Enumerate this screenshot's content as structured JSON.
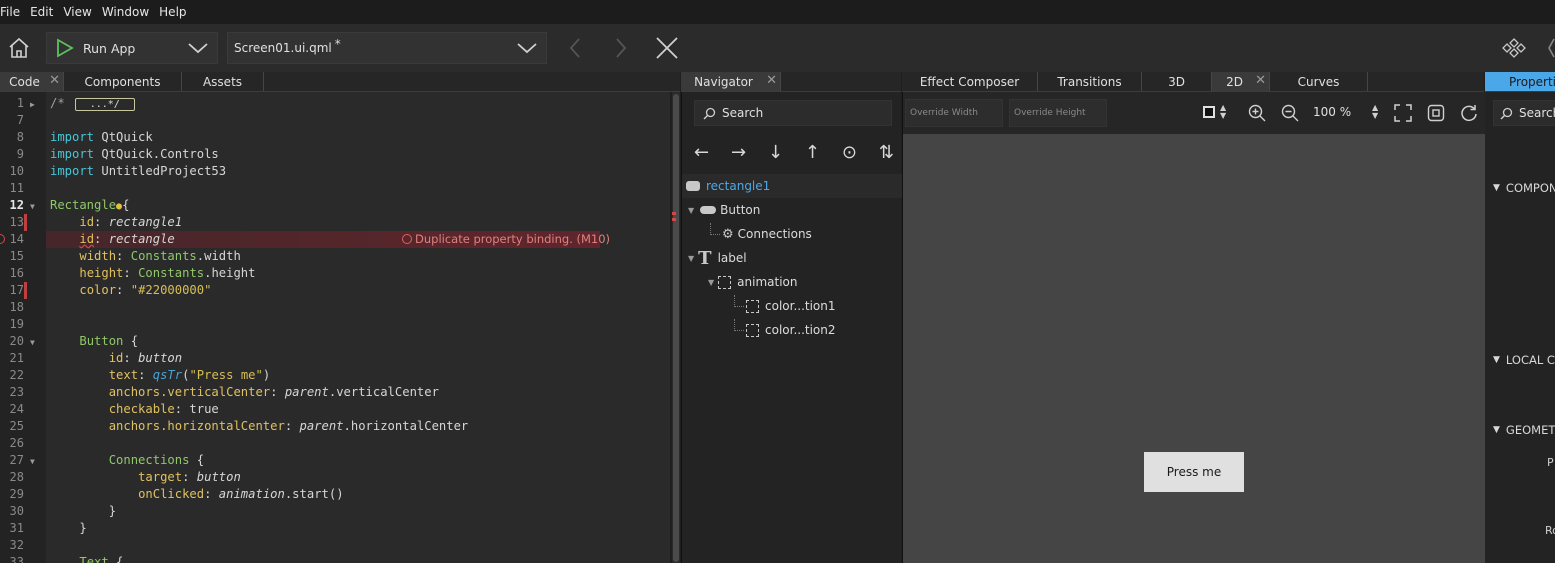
{
  "menu": [
    "File",
    "Edit",
    "View",
    "Window",
    "Help"
  ],
  "toolbar": {
    "run_label": "Run App",
    "file_label": "Screen01.ui.qml",
    "modified_marker": "*"
  },
  "colors": {
    "accent": "#4aa8e8",
    "error": "#d04848",
    "play": "#5cc25c"
  },
  "editor_tabs": [
    {
      "label": "Code",
      "active": true
    },
    {
      "label": "Components",
      "active": false
    },
    {
      "label": "Assets",
      "active": false
    }
  ],
  "navigator_tab": "Navigator",
  "view_tabs": [
    {
      "label": "Effect Composer",
      "active": false
    },
    {
      "label": "Transitions",
      "active": false
    },
    {
      "label": "3D",
      "active": false
    },
    {
      "label": "2D",
      "active": true
    },
    {
      "label": "Curves",
      "active": false
    }
  ],
  "properties_tab": "Properties",
  "code_lines": [
    {
      "n": "1",
      "text": "/*",
      "collapsed": "...*/"
    },
    {
      "n": "7",
      "text": ""
    },
    {
      "n": "8",
      "text": "import QtQuick"
    },
    {
      "n": "9",
      "text": "import QtQuick.Controls"
    },
    {
      "n": "10",
      "text": "import UntitledProject53"
    },
    {
      "n": "11",
      "text": ""
    },
    {
      "n": "12",
      "text": "Rectangle {"
    },
    {
      "n": "13",
      "text": "id: rectangle1"
    },
    {
      "n": "14",
      "text": "id: rectangle"
    },
    {
      "n": "15",
      "text": "width: Constants.width"
    },
    {
      "n": "16",
      "text": "height: Constants.height"
    },
    {
      "n": "17",
      "text": "color: \"#22000000\""
    },
    {
      "n": "18",
      "text": ""
    },
    {
      "n": "19",
      "text": ""
    },
    {
      "n": "20",
      "text": "Button {"
    },
    {
      "n": "21",
      "text": "id: button"
    },
    {
      "n": "22",
      "text": "text: qsTr(\"Press me\")"
    },
    {
      "n": "23",
      "text": "anchors.verticalCenter: parent.verticalCenter"
    },
    {
      "n": "24",
      "text": "checkable: true"
    },
    {
      "n": "25",
      "text": "anchors.horizontalCenter: parent.horizontalCenter"
    },
    {
      "n": "26",
      "text": ""
    },
    {
      "n": "27",
      "text": "Connections {"
    },
    {
      "n": "28",
      "text": "target: button"
    },
    {
      "n": "29",
      "text": "onClicked: animation.start()"
    },
    {
      "n": "30",
      "text": "}"
    },
    {
      "n": "31",
      "text": "}"
    },
    {
      "n": "32",
      "text": ""
    },
    {
      "n": "33",
      "text": "Text {"
    }
  ],
  "error_message": "Duplicate property binding. (M10)",
  "navigator": {
    "search_placeholder": "Search",
    "tools": [
      "←",
      "→",
      "↓",
      "↑",
      "⊙",
      "⇅"
    ],
    "items": [
      {
        "label": "rectangle1",
        "icon": "rectangle-icon",
        "selected": true
      },
      {
        "label": "Button",
        "icon": "button-icon"
      },
      {
        "label": "Connections",
        "icon": "connections-icon"
      },
      {
        "label": "label",
        "icon": "text-icon"
      },
      {
        "label": "animation",
        "icon": "item-icon"
      },
      {
        "label": "color...tion1",
        "icon": "item-icon"
      },
      {
        "label": "color...tion2",
        "icon": "item-icon"
      }
    ]
  },
  "view": {
    "override_width": "Override Width",
    "override_height": "Override Height",
    "zoom": "100 %",
    "button_text": "Press me"
  },
  "properties": {
    "search_placeholder": "Search",
    "sections": [
      "COMPONENT",
      "LOCAL CUSTOM PROPERTIES",
      "GEOMETRY"
    ],
    "field_labels": [
      "P",
      "Ro"
    ]
  }
}
